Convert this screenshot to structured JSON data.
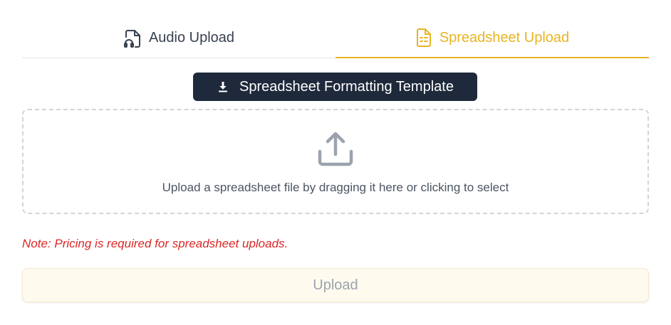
{
  "tabs": [
    {
      "label": "Audio Upload",
      "icon": "audio-file-icon",
      "active": false
    },
    {
      "label": "Spreadsheet Upload",
      "icon": "spreadsheet-file-icon",
      "active": true
    }
  ],
  "template_button": {
    "label": "Spreadsheet Formatting Template",
    "icon": "download-icon"
  },
  "dropzone": {
    "icon": "upload-icon",
    "text": "Upload a spreadsheet file by dragging it here or clicking to select"
  },
  "note": "Note: Pricing is required for spreadsheet uploads.",
  "upload_button": {
    "label": "Upload",
    "disabled": true
  },
  "colors": {
    "accent": "#e8b422",
    "dark_button": "#1e293b",
    "note_red": "#dc2626",
    "upload_bg": "#fefaed",
    "border": "#d1d5db"
  }
}
